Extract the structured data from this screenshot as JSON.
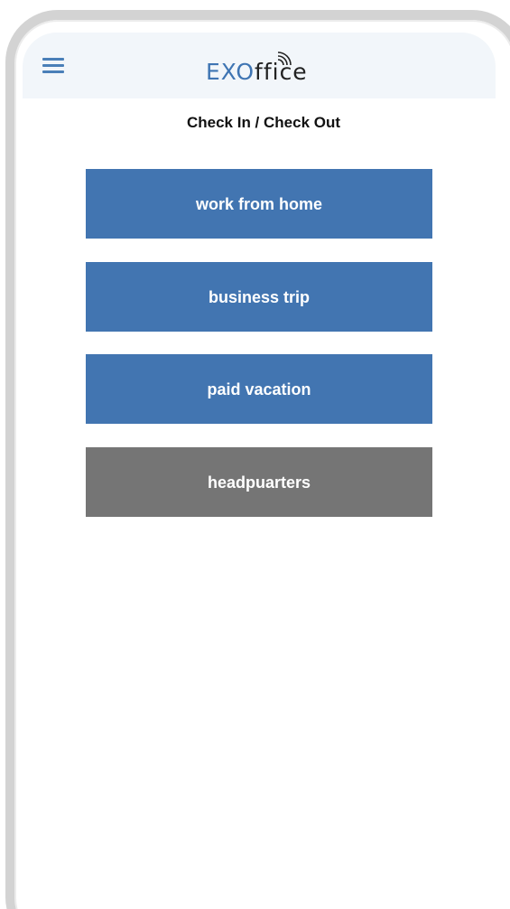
{
  "app": {
    "logo_prefix": "EXO",
    "logo_suffix": "ffice",
    "logo_icon": "wifi-signal-icon",
    "menu_icon": "hamburger-menu-icon"
  },
  "page": {
    "title": "Check In / Check Out"
  },
  "buttons": [
    {
      "label": "work from home",
      "color": "#4275b1"
    },
    {
      "label": "business trip",
      "color": "#4275b1"
    },
    {
      "label": "paid vacation",
      "color": "#4275b1"
    },
    {
      "label": "headpuarters",
      "color": "#757575"
    }
  ],
  "colors": {
    "header_bg": "#f2f6fa",
    "accent": "#4275b1",
    "inactive": "#757575",
    "frame": "#d3d3d3"
  }
}
